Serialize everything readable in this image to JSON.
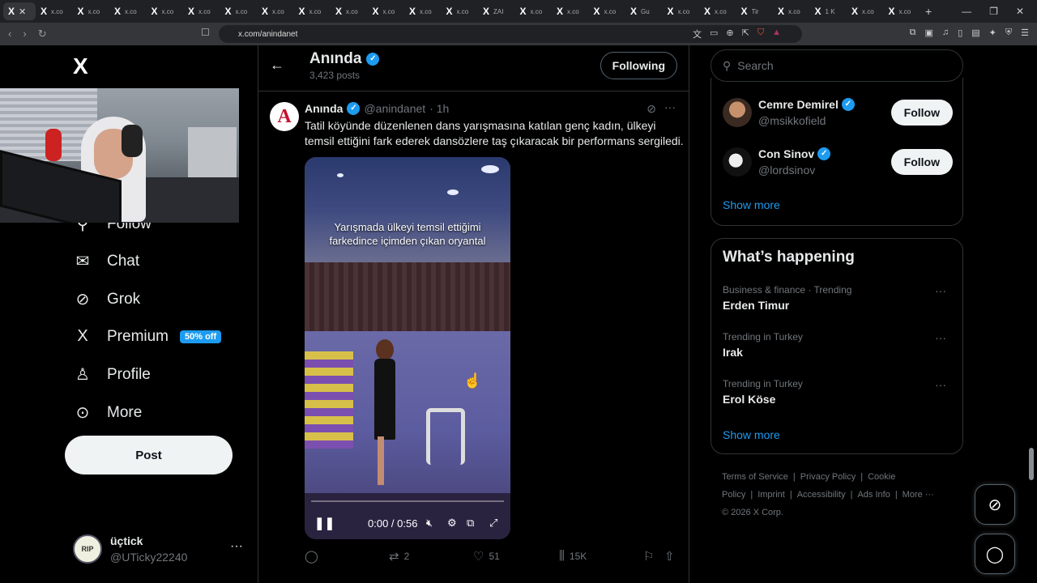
{
  "browser": {
    "tabs": [
      {
        "icon": "X",
        "label": ""
      },
      {
        "icon": "X",
        "label": "x.co"
      },
      {
        "icon": "X",
        "label": "x.co"
      },
      {
        "icon": "X",
        "label": "x.co"
      },
      {
        "icon": "X",
        "label": "x.co"
      },
      {
        "icon": "X",
        "label": "x.co"
      },
      {
        "icon": "X",
        "label": "x.co"
      },
      {
        "icon": "X",
        "label": "x.co"
      },
      {
        "icon": "X",
        "label": "x.co"
      },
      {
        "icon": "X",
        "label": "x.co"
      },
      {
        "icon": "X",
        "label": "x.co"
      },
      {
        "icon": "X",
        "label": "x.co"
      },
      {
        "icon": "X",
        "label": "x.co"
      },
      {
        "icon": "X",
        "label": "ZAI"
      },
      {
        "icon": "X",
        "label": "x.co"
      },
      {
        "icon": "X",
        "label": "x.co"
      },
      {
        "icon": "X",
        "label": "x.co"
      },
      {
        "icon": "X",
        "label": "Gu"
      },
      {
        "icon": "X",
        "label": "x.co"
      },
      {
        "icon": "X",
        "label": "x.co"
      },
      {
        "icon": "X",
        "label": "Tir"
      },
      {
        "icon": "X",
        "label": "x.co"
      },
      {
        "icon": "X",
        "label": "1 K"
      },
      {
        "icon": "X",
        "label": "x.co"
      },
      {
        "icon": "X",
        "label": "x.co"
      }
    ],
    "url": "x.com/anindanet"
  },
  "nav": {
    "logo": "X",
    "items": [
      {
        "label": "Follow",
        "icon": "person-plus-icon"
      },
      {
        "label": "Chat",
        "icon": "mail-icon"
      },
      {
        "label": "Grok",
        "icon": "grok-icon"
      },
      {
        "label": "Premium",
        "icon": "x-premium-icon",
        "badge": "50% off"
      },
      {
        "label": "Profile",
        "icon": "profile-icon"
      },
      {
        "label": "More",
        "icon": "more-circle-icon"
      }
    ],
    "post_label": "Post",
    "user": {
      "name": "üçtick",
      "handle": "@UTicky22240",
      "avatar_text": "RIP"
    }
  },
  "profile": {
    "name": "Anında",
    "posts": "3,423 posts",
    "following_label": "Following"
  },
  "tweet": {
    "author": "Anında",
    "handle": "@anindanet",
    "time": "· 1h",
    "avatar_letter": "A",
    "text": "Tatil köyünde düzenlenen dans yarışmasına katılan genç kadın, ülkeyi temsil ettiğini fark ederek dansözlere taş çıkaracak bir performans sergiledi.",
    "video": {
      "caption": "Yarışmada ülkeyi temsil ettiğimi farkedince içimden çıkan oryantal",
      "time": "0:00 / 0:56",
      "progress": 0.0
    },
    "actions": {
      "replies": "",
      "reposts": "2",
      "likes": "51",
      "views": "15K"
    }
  },
  "sidebar": {
    "search_placeholder": "Search",
    "who_to_follow": [
      {
        "name": "Cemre Demirel",
        "handle": "@msikkofield",
        "button": "Follow"
      },
      {
        "name": "Con Sinov",
        "handle": "@lordsinov",
        "button": "Follow"
      }
    ],
    "who_show_more": "Show more",
    "happening_title": "What’s happening",
    "trends": [
      {
        "meta": "Business & finance · Trending",
        "topic": "Erden Timur"
      },
      {
        "meta": "Trending in Turkey",
        "topic": "Irak"
      },
      {
        "meta": "Trending in Turkey",
        "topic": "Erol Köse"
      }
    ],
    "happening_show_more": "Show more",
    "footer": {
      "links": [
        "Terms of Service",
        "|",
        "Privacy Policy",
        "|",
        "Cookie Policy",
        "|",
        "Imprint",
        "|",
        "Accessibility",
        "|",
        "Ads Info",
        "|",
        "More ···"
      ],
      "copyright": "© 2026 X Corp."
    }
  },
  "colors": {
    "accent": "#1d9bf0",
    "background": "#000000",
    "text": "#e7e9ea",
    "muted": "#71767b"
  }
}
